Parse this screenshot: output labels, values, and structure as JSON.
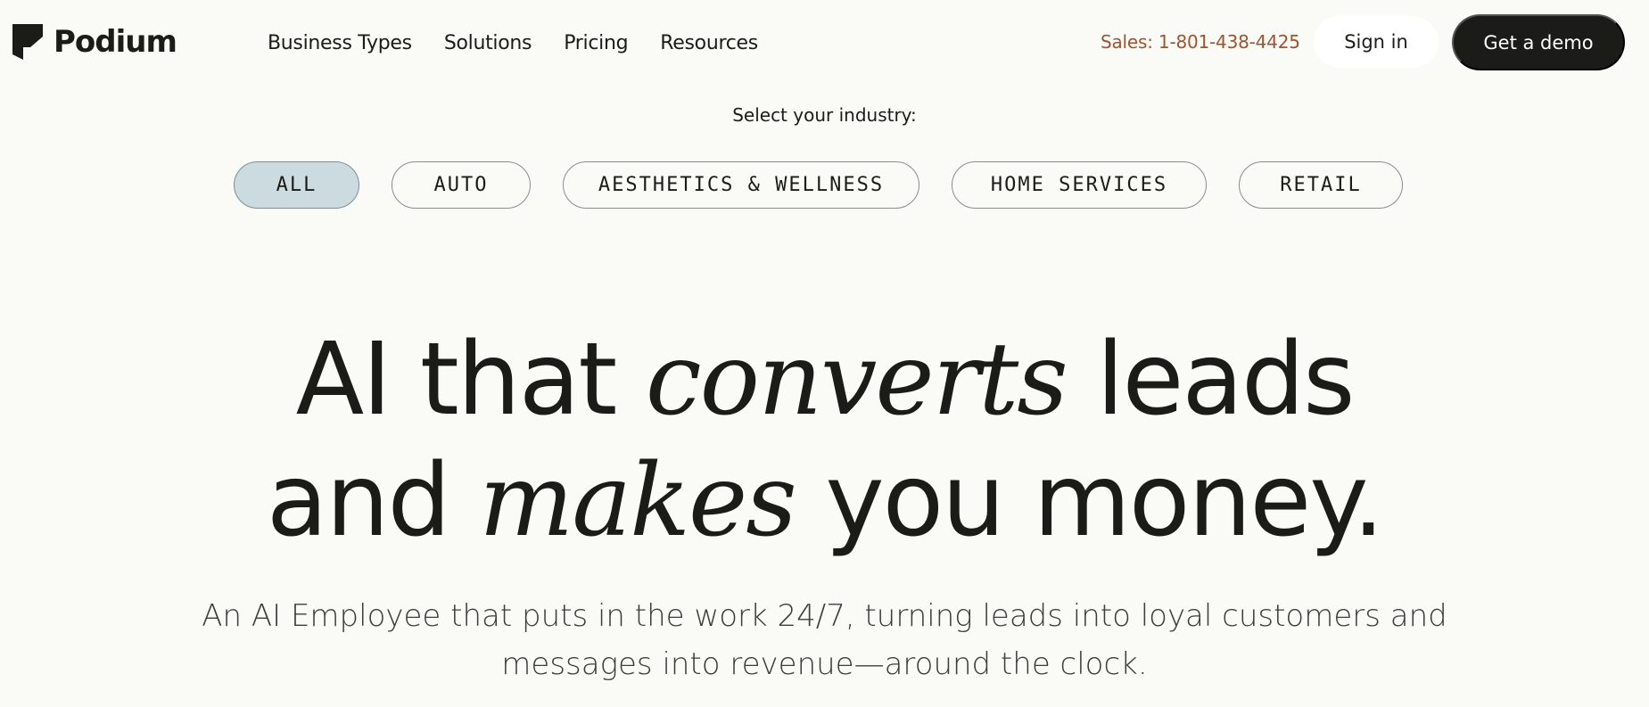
{
  "header": {
    "logo_text": "Podium",
    "nav": [
      "Business Types",
      "Solutions",
      "Pricing",
      "Resources"
    ],
    "sales_label": "Sales: 1-801-438-4425",
    "signin_label": "Sign in",
    "demo_label": "Get a demo"
  },
  "industry": {
    "label": "Select your industry:",
    "chips": [
      "ALL",
      "AUTO",
      "AESTHETICS & WELLNESS",
      "HOME SERVICES",
      "RETAIL"
    ],
    "selected": "ALL"
  },
  "hero": {
    "line1_a": "AI that ",
    "line1_em": "converts",
    "line1_b": " leads",
    "line2_a": "and ",
    "line2_em": "makes",
    "line2_b": " you money."
  },
  "subheadline": {
    "line1": "An AI Employee that puts in the work 24/7, turning leads into loyal customers and",
    "line2": "messages into revenue—around the clock."
  },
  "colors": {
    "background": "#fafaf6",
    "text": "#1b1b17",
    "sales": "#a0532e",
    "chip_active": "#cbdbe0",
    "button_dark": "#1b1b17"
  },
  "icons": {
    "logo": "podium-logo-icon"
  }
}
